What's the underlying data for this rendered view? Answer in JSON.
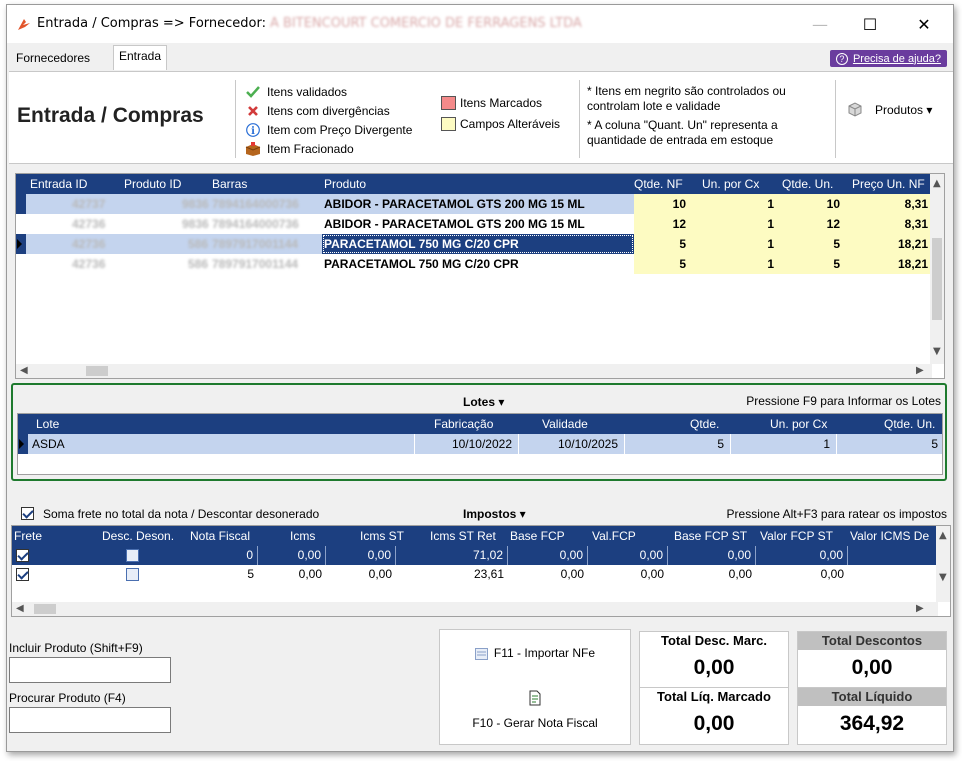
{
  "window": {
    "title_prefix": "Entrada / Compras => Fornecedor:",
    "title_supplier": "A BITENCOURT COMERCIO DE FERRAGENS LTDA",
    "minimize": "—",
    "maximize": "☐",
    "close": "✕"
  },
  "tabs": [
    "Fornecedores",
    "Entrada"
  ],
  "help_label": "Precisa de ajuda?",
  "header": {
    "title": "Entrada / Compras",
    "legend": [
      {
        "icon": "check-icon",
        "label": "Itens validados"
      },
      {
        "icon": "x-icon",
        "label": "Itens com divergências"
      },
      {
        "icon": "info-icon",
        "label": "Item com Preço Divergente"
      },
      {
        "icon": "box-icon",
        "label": "Item Fracionado"
      }
    ],
    "swatches": [
      {
        "label": "Itens Marcados",
        "color": "#f48a8a"
      },
      {
        "label": "Campos Alteráveis",
        "color": "#fdfbc2"
      }
    ],
    "notes": [
      "* Itens em negrito são controlados ou controlam lote e validade",
      "* A coluna \"Quant. Un\" representa a quantidade de entrada em estoque"
    ],
    "produtos_label": "Produtos ▾"
  },
  "products": {
    "columns": [
      "Entrada ID",
      "Produto ID",
      "Barras",
      "Produto",
      "Qtde. NF",
      "Un. por Cx",
      "Qtde. Un.",
      "Preço Un. NF"
    ],
    "rows": [
      {
        "entrada_id": "42737",
        "produto_id": "9836",
        "barras": "7894164000736",
        "produto": "ABIDOR - PARACETAMOL GTS 200 MG 15 ML",
        "qtde_nf": "10",
        "un_cx": "1",
        "qtde_un": "10",
        "preco": "8,31"
      },
      {
        "entrada_id": "42736",
        "produto_id": "9836",
        "barras": "7894164000736",
        "produto": "ABIDOR - PARACETAMOL GTS 200 MG 15 ML",
        "qtde_nf": "12",
        "un_cx": "1",
        "qtde_un": "12",
        "preco": "8,31"
      },
      {
        "entrada_id": "42736",
        "produto_id": "586",
        "barras": "7897917001144",
        "produto": "PARACETAMOL 750 MG C/20 CPR",
        "qtde_nf": "5",
        "un_cx": "1",
        "qtde_un": "5",
        "preco": "18,21"
      },
      {
        "entrada_id": "42736",
        "produto_id": "586",
        "barras": "7897917001144",
        "produto": "PARACETAMOL 750 MG C/20 CPR",
        "qtde_nf": "5",
        "un_cx": "1",
        "qtde_un": "5",
        "preco": "18,21"
      }
    ]
  },
  "lotes": {
    "title": "Lotes ▾",
    "hint": "Pressione F9 para Informar os Lotes",
    "columns": [
      "Lote",
      "Fabricação",
      "Validade",
      "Qtde.",
      "Un. por Cx",
      "Qtde. Un."
    ],
    "rows": [
      {
        "lote": "ASDA",
        "fabricacao": "10/10/2022",
        "validade": "10/10/2025",
        "qtde": "5",
        "un_cx": "1",
        "qtde_un": "5"
      }
    ]
  },
  "impostos": {
    "soma_label": "Soma frete no total da nota / Descontar desonerado",
    "title": "Impostos ▾",
    "hint": "Pressione Alt+F3 para ratear os impostos",
    "columns": [
      "Frete",
      "Desc. Deson.",
      "Nota Fiscal",
      "Icms",
      "Icms ST",
      "Icms ST Ret",
      "Base FCP",
      "Val.FCP",
      "Base FCP ST",
      "Valor FCP ST",
      "Valor ICMS De"
    ],
    "rows": [
      {
        "nota": "0",
        "icms": "0,00",
        "icms_st": "0,00",
        "icms_st_ret": "71,02",
        "base_fcp": "0,00",
        "val_fcp": "0,00",
        "base_fcp_st": "0,00",
        "valor_fcp_st": "0,00"
      },
      {
        "nota": "5",
        "icms": "0,00",
        "icms_st": "0,00",
        "icms_st_ret": "23,61",
        "base_fcp": "0,00",
        "val_fcp": "0,00",
        "base_fcp_st": "0,00",
        "valor_fcp_st": "0,00"
      }
    ]
  },
  "bottom": {
    "incluir_label": "Incluir Produto (Shift+F9)",
    "procurar_label": "Procurar Produto (F4)",
    "importar_label": "F11 - Importar NFe",
    "gerar_label": "F10 - Gerar Nota Fiscal",
    "total_desc_marc_label": "Total Desc. Marc.",
    "total_desc_marc": "0,00",
    "total_descontos_label": "Total Descontos",
    "total_descontos": "0,00",
    "total_liq_marcado_label": "Total Líq. Marcado",
    "total_liq_marcado": "0,00",
    "total_liquido_label": "Total Líquido",
    "total_liquido": "364,92"
  },
  "colors": {
    "accent": "#1c3f80",
    "selection": "#c4d4ee",
    "editable": "#fdfbc2",
    "lotes_border": "#1e7a2e",
    "help_button": "#6a3c9e"
  }
}
